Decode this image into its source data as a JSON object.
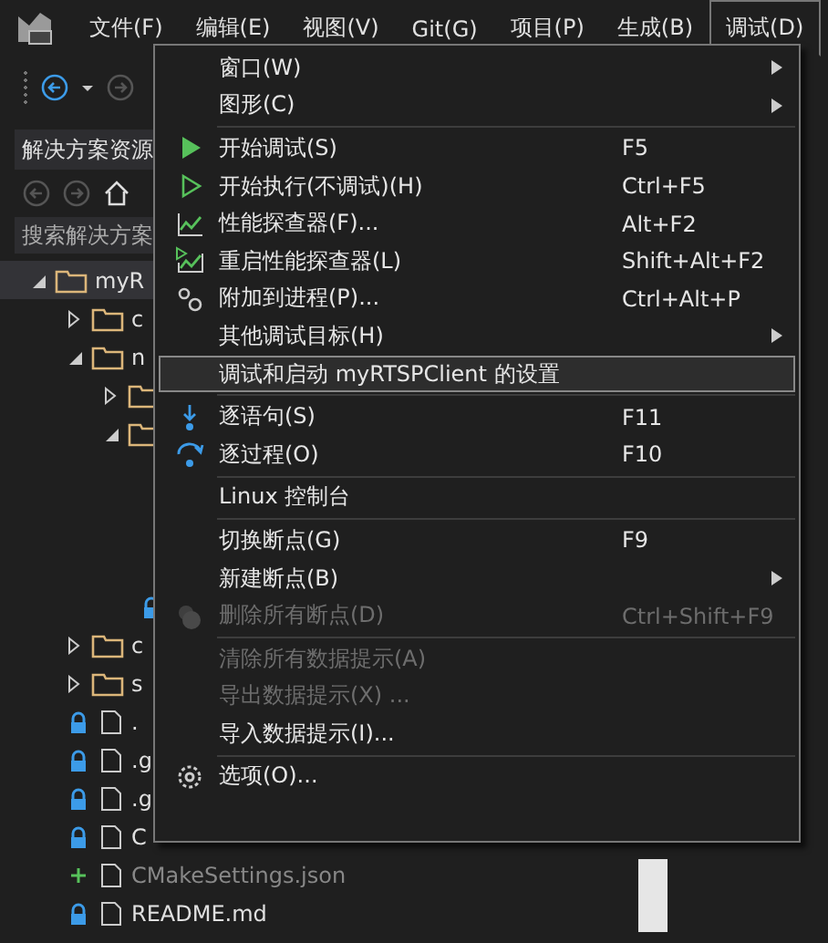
{
  "menubar": [
    {
      "label": "文件(F)",
      "selected": false
    },
    {
      "label": "编辑(E)",
      "selected": false
    },
    {
      "label": "视图(V)",
      "selected": false
    },
    {
      "label": "Git(G)",
      "selected": false
    },
    {
      "label": "项目(P)",
      "selected": false
    },
    {
      "label": "生成(B)",
      "selected": false
    },
    {
      "label": "调试(D)",
      "selected": true
    }
  ],
  "solution_explorer": {
    "title": "解决方案资源",
    "search": {
      "placeholder": "搜索解决方案"
    },
    "tree": [
      {
        "kind": "folder",
        "label": "myR",
        "expanded": true,
        "selected": true,
        "children": [
          {
            "kind": "folder",
            "label": "c",
            "expanded": false,
            "selected": false
          },
          {
            "kind": "folder",
            "label": "n",
            "expanded": true,
            "selected": false,
            "children": [
              {
                "kind": "folder",
                "expanded": false,
                "selected": false
              },
              {
                "kind": "folder",
                "expanded": true,
                "selected": false,
                "children": [
                  {
                    "locked": true,
                    "selected": false
                  }
                ]
              }
            ]
          },
          {
            "kind": "folder",
            "label": "c",
            "expanded": false,
            "selected": false
          },
          {
            "kind": "folder",
            "label": "s",
            "expanded": false,
            "selected": false
          },
          {
            "kind": "file",
            "label": ".",
            "locked": true,
            "selected": false
          },
          {
            "kind": "file",
            "label": ".g",
            "locked": true,
            "selected": false
          },
          {
            "kind": "file",
            "label": ".g",
            "locked": true,
            "selected": false
          },
          {
            "kind": "file",
            "label": "C",
            "locked": true,
            "selected": false
          },
          {
            "kind": "file",
            "label": "CMakeSettings.json",
            "added": true,
            "selected": false
          },
          {
            "kind": "file",
            "label": "README.md",
            "locked": true,
            "selected": false
          }
        ]
      }
    ]
  },
  "debug_menu": [
    {
      "kind": "item",
      "label": "窗口(W)",
      "submenu": true,
      "disabled": false,
      "highlighted": false
    },
    {
      "kind": "item",
      "label": "图形(C)",
      "submenu": true,
      "disabled": false,
      "highlighted": false
    },
    {
      "kind": "separator"
    },
    {
      "kind": "item",
      "label": "开始调试(S)",
      "shortcut": "F5",
      "disabled": false,
      "highlighted": false
    },
    {
      "kind": "item",
      "label": "开始执行(不调试)(H)",
      "shortcut": "Ctrl+F5",
      "disabled": false,
      "highlighted": false
    },
    {
      "kind": "item",
      "label": "性能探查器(F)...",
      "shortcut": "Alt+F2",
      "disabled": false,
      "highlighted": false
    },
    {
      "kind": "item",
      "label": "重启性能探查器(L)",
      "shortcut": "Shift+Alt+F2",
      "disabled": false,
      "highlighted": false
    },
    {
      "kind": "item",
      "label": "附加到进程(P)...",
      "shortcut": "Ctrl+Alt+P",
      "disabled": false,
      "highlighted": false
    },
    {
      "kind": "item",
      "label": "其他调试目标(H)",
      "submenu": true,
      "disabled": false,
      "highlighted": false
    },
    {
      "kind": "item",
      "label": "调试和启动 myRTSPClient 的设置",
      "disabled": false,
      "highlighted": true
    },
    {
      "kind": "separator"
    },
    {
      "kind": "item",
      "label": "逐语句(S)",
      "shortcut": "F11",
      "disabled": false,
      "highlighted": false
    },
    {
      "kind": "item",
      "label": "逐过程(O)",
      "shortcut": "F10",
      "disabled": false,
      "highlighted": false
    },
    {
      "kind": "separator"
    },
    {
      "kind": "item",
      "label": "Linux 控制台",
      "disabled": false,
      "highlighted": false
    },
    {
      "kind": "separator"
    },
    {
      "kind": "item",
      "label": "切换断点(G)",
      "shortcut": "F9",
      "disabled": false,
      "highlighted": false
    },
    {
      "kind": "item",
      "label": "新建断点(B)",
      "submenu": true,
      "disabled": false,
      "highlighted": false
    },
    {
      "kind": "item",
      "label": "删除所有断点(D)",
      "shortcut": "Ctrl+Shift+F9",
      "disabled": true,
      "highlighted": false
    },
    {
      "kind": "separator"
    },
    {
      "kind": "item",
      "label": "清除所有数据提示(A)",
      "disabled": true,
      "highlighted": false
    },
    {
      "kind": "item",
      "label": "导出数据提示(X) ...",
      "disabled": true,
      "highlighted": false
    },
    {
      "kind": "item",
      "label": "导入数据提示(I)...",
      "disabled": false,
      "highlighted": false
    },
    {
      "kind": "separator"
    },
    {
      "kind": "item",
      "label": "选项(O)...",
      "disabled": false,
      "highlighted": false
    }
  ]
}
